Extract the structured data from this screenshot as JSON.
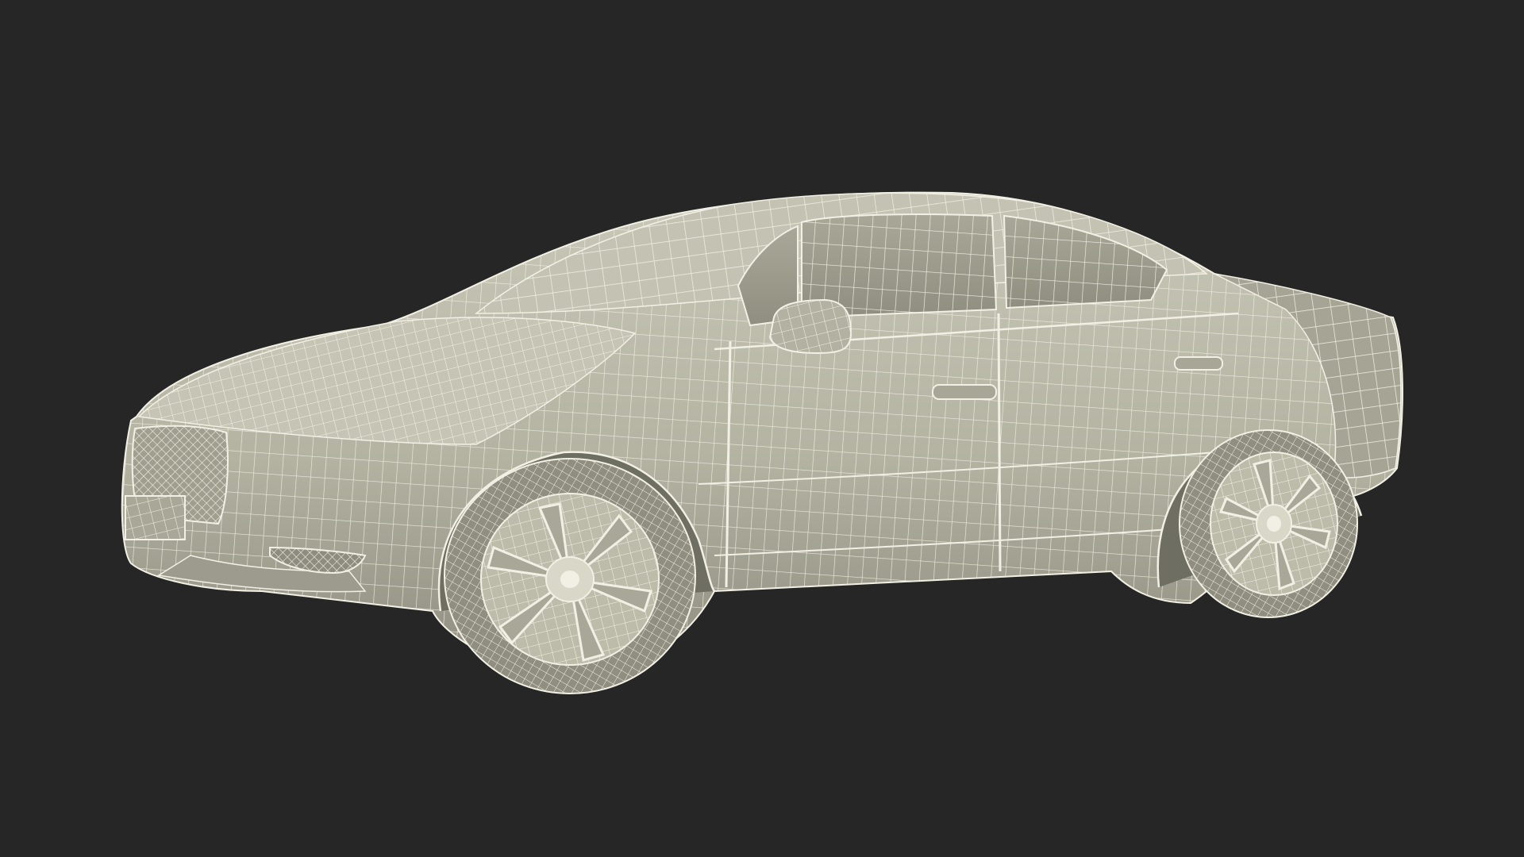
{
  "scene": {
    "background_color": "#262626",
    "body_fill": "#bdbcab",
    "body_shade": "#8f8e80",
    "body_dark": "#6f6e62",
    "wire_color": "#f2f0e4"
  }
}
